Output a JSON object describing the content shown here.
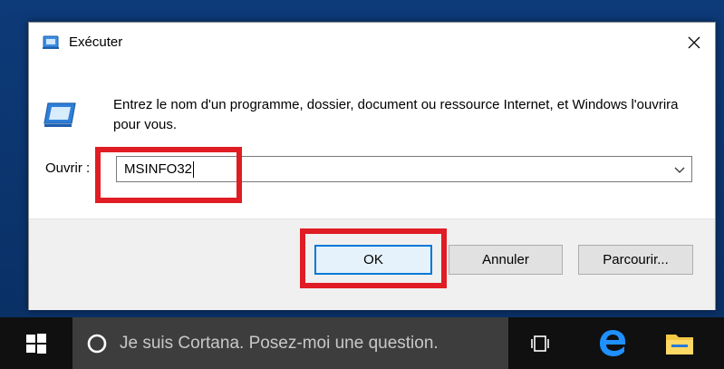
{
  "dialog": {
    "title": "Exécuter",
    "description": "Entrez le nom d'un programme, dossier, document ou ressource Internet, et Windows l'ouvrira pour vous.",
    "open_label": "Ouvrir :",
    "open_value": "MSINFO32",
    "buttons": {
      "ok": "OK",
      "cancel": "Annuler",
      "browse": "Parcourir..."
    },
    "close_icon": "close-icon",
    "title_icon": "run-icon"
  },
  "taskbar": {
    "search_placeholder": "Je suis Cortana. Posez-moi une question.",
    "icons": [
      "windows-start-icon",
      "cortana-icon",
      "task-view-icon",
      "edge-icon",
      "file-explorer-icon"
    ]
  },
  "colors": {
    "highlight": "#e01c24",
    "accent": "#0078d7",
    "taskbar": "#101010",
    "search_box": "#3d3d3d",
    "desktop": "#0d3a78"
  }
}
